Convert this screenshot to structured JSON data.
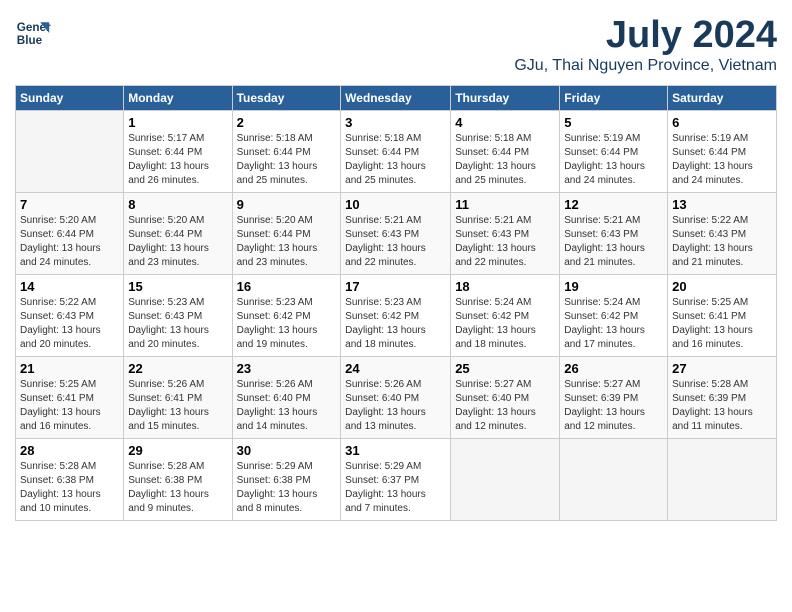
{
  "header": {
    "logo_line1": "General",
    "logo_line2": "Blue",
    "month": "July 2024",
    "location": "GJu, Thai Nguyen Province, Vietnam"
  },
  "weekdays": [
    "Sunday",
    "Monday",
    "Tuesday",
    "Wednesday",
    "Thursday",
    "Friday",
    "Saturday"
  ],
  "weeks": [
    [
      {
        "day": "",
        "info": ""
      },
      {
        "day": "1",
        "info": "Sunrise: 5:17 AM\nSunset: 6:44 PM\nDaylight: 13 hours\nand 26 minutes."
      },
      {
        "day": "2",
        "info": "Sunrise: 5:18 AM\nSunset: 6:44 PM\nDaylight: 13 hours\nand 25 minutes."
      },
      {
        "day": "3",
        "info": "Sunrise: 5:18 AM\nSunset: 6:44 PM\nDaylight: 13 hours\nand 25 minutes."
      },
      {
        "day": "4",
        "info": "Sunrise: 5:18 AM\nSunset: 6:44 PM\nDaylight: 13 hours\nand 25 minutes."
      },
      {
        "day": "5",
        "info": "Sunrise: 5:19 AM\nSunset: 6:44 PM\nDaylight: 13 hours\nand 24 minutes."
      },
      {
        "day": "6",
        "info": "Sunrise: 5:19 AM\nSunset: 6:44 PM\nDaylight: 13 hours\nand 24 minutes."
      }
    ],
    [
      {
        "day": "7",
        "info": "Sunrise: 5:20 AM\nSunset: 6:44 PM\nDaylight: 13 hours\nand 24 minutes."
      },
      {
        "day": "8",
        "info": "Sunrise: 5:20 AM\nSunset: 6:44 PM\nDaylight: 13 hours\nand 23 minutes."
      },
      {
        "day": "9",
        "info": "Sunrise: 5:20 AM\nSunset: 6:44 PM\nDaylight: 13 hours\nand 23 minutes."
      },
      {
        "day": "10",
        "info": "Sunrise: 5:21 AM\nSunset: 6:43 PM\nDaylight: 13 hours\nand 22 minutes."
      },
      {
        "day": "11",
        "info": "Sunrise: 5:21 AM\nSunset: 6:43 PM\nDaylight: 13 hours\nand 22 minutes."
      },
      {
        "day": "12",
        "info": "Sunrise: 5:21 AM\nSunset: 6:43 PM\nDaylight: 13 hours\nand 21 minutes."
      },
      {
        "day": "13",
        "info": "Sunrise: 5:22 AM\nSunset: 6:43 PM\nDaylight: 13 hours\nand 21 minutes."
      }
    ],
    [
      {
        "day": "14",
        "info": "Sunrise: 5:22 AM\nSunset: 6:43 PM\nDaylight: 13 hours\nand 20 minutes."
      },
      {
        "day": "15",
        "info": "Sunrise: 5:23 AM\nSunset: 6:43 PM\nDaylight: 13 hours\nand 20 minutes."
      },
      {
        "day": "16",
        "info": "Sunrise: 5:23 AM\nSunset: 6:42 PM\nDaylight: 13 hours\nand 19 minutes."
      },
      {
        "day": "17",
        "info": "Sunrise: 5:23 AM\nSunset: 6:42 PM\nDaylight: 13 hours\nand 18 minutes."
      },
      {
        "day": "18",
        "info": "Sunrise: 5:24 AM\nSunset: 6:42 PM\nDaylight: 13 hours\nand 18 minutes."
      },
      {
        "day": "19",
        "info": "Sunrise: 5:24 AM\nSunset: 6:42 PM\nDaylight: 13 hours\nand 17 minutes."
      },
      {
        "day": "20",
        "info": "Sunrise: 5:25 AM\nSunset: 6:41 PM\nDaylight: 13 hours\nand 16 minutes."
      }
    ],
    [
      {
        "day": "21",
        "info": "Sunrise: 5:25 AM\nSunset: 6:41 PM\nDaylight: 13 hours\nand 16 minutes."
      },
      {
        "day": "22",
        "info": "Sunrise: 5:26 AM\nSunset: 6:41 PM\nDaylight: 13 hours\nand 15 minutes."
      },
      {
        "day": "23",
        "info": "Sunrise: 5:26 AM\nSunset: 6:40 PM\nDaylight: 13 hours\nand 14 minutes."
      },
      {
        "day": "24",
        "info": "Sunrise: 5:26 AM\nSunset: 6:40 PM\nDaylight: 13 hours\nand 13 minutes."
      },
      {
        "day": "25",
        "info": "Sunrise: 5:27 AM\nSunset: 6:40 PM\nDaylight: 13 hours\nand 12 minutes."
      },
      {
        "day": "26",
        "info": "Sunrise: 5:27 AM\nSunset: 6:39 PM\nDaylight: 13 hours\nand 12 minutes."
      },
      {
        "day": "27",
        "info": "Sunrise: 5:28 AM\nSunset: 6:39 PM\nDaylight: 13 hours\nand 11 minutes."
      }
    ],
    [
      {
        "day": "28",
        "info": "Sunrise: 5:28 AM\nSunset: 6:38 PM\nDaylight: 13 hours\nand 10 minutes."
      },
      {
        "day": "29",
        "info": "Sunrise: 5:28 AM\nSunset: 6:38 PM\nDaylight: 13 hours\nand 9 minutes."
      },
      {
        "day": "30",
        "info": "Sunrise: 5:29 AM\nSunset: 6:38 PM\nDaylight: 13 hours\nand 8 minutes."
      },
      {
        "day": "31",
        "info": "Sunrise: 5:29 AM\nSunset: 6:37 PM\nDaylight: 13 hours\nand 7 minutes."
      },
      {
        "day": "",
        "info": ""
      },
      {
        "day": "",
        "info": ""
      },
      {
        "day": "",
        "info": ""
      }
    ]
  ]
}
